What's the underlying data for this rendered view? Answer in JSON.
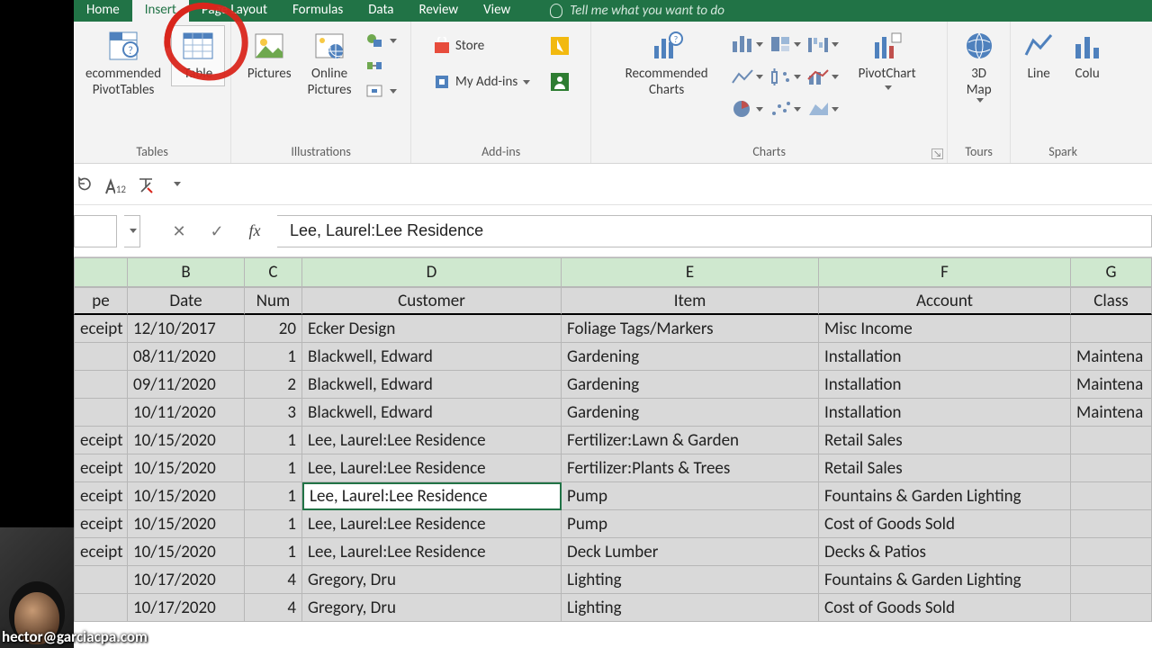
{
  "tabs": {
    "home": "Home",
    "insert": "Insert",
    "page_layout": "Page Layout",
    "formulas": "Formulas",
    "data": "Data",
    "review": "Review",
    "view": "View",
    "tell_me": "Tell me what you want to do"
  },
  "ribbon": {
    "tables_label": "Tables",
    "recommended_pivot": "ecommended\nPivotTables",
    "table": "Table",
    "illustrations_label": "Illustrations",
    "pictures": "Pictures",
    "online_pictures": "Online\nPictures",
    "addins_label": "Add-ins",
    "store": "Store",
    "my_addins": "My Add-ins",
    "charts_label": "Charts",
    "recommended_charts": "Recommended\nCharts",
    "pivot_chart": "PivotChart",
    "tours_label": "Tours",
    "map3d": "3D\nMap",
    "spark_label": "Spark",
    "line": "Line",
    "column": "Colu"
  },
  "qat": {
    "size": "12"
  },
  "formula": {
    "value": "Lee, Laurel:Lee Residence"
  },
  "columns": {
    "A": "",
    "B": "B",
    "C": "C",
    "D": "D",
    "E": "E",
    "F": "F",
    "G": "G"
  },
  "headers": {
    "type": "pe",
    "date": "Date",
    "num": "Num",
    "customer": "Customer",
    "item": "Item",
    "account": "Account",
    "class": "Class"
  },
  "rows": [
    {
      "type": "eceipt",
      "date": "12/10/2017",
      "num": "20",
      "customer": "Ecker Design",
      "item": "Foliage Tags/Markers",
      "account": "Misc Income",
      "class": ""
    },
    {
      "type": "",
      "date": "08/11/2020",
      "num": "1",
      "customer": "Blackwell, Edward",
      "item": "Gardening",
      "account": "Installation",
      "class": "Maintena"
    },
    {
      "type": "",
      "date": "09/11/2020",
      "num": "2",
      "customer": "Blackwell, Edward",
      "item": "Gardening",
      "account": "Installation",
      "class": "Maintena"
    },
    {
      "type": "",
      "date": "10/11/2020",
      "num": "3",
      "customer": "Blackwell, Edward",
      "item": "Gardening",
      "account": "Installation",
      "class": "Maintena"
    },
    {
      "type": "eceipt",
      "date": "10/15/2020",
      "num": "1",
      "customer": "Lee, Laurel:Lee Residence",
      "item": "Fertilizer:Lawn & Garden",
      "account": "Retail Sales",
      "class": ""
    },
    {
      "type": "eceipt",
      "date": "10/15/2020",
      "num": "1",
      "customer": "Lee, Laurel:Lee Residence",
      "item": "Fertilizer:Plants & Trees",
      "account": "Retail Sales",
      "class": ""
    },
    {
      "type": "eceipt",
      "date": "10/15/2020",
      "num": "1",
      "customer": "Lee, Laurel:Lee Residence",
      "item": "Pump",
      "account": "Fountains & Garden Lighting",
      "class": "",
      "selected": true
    },
    {
      "type": "eceipt",
      "date": "10/15/2020",
      "num": "1",
      "customer": "Lee, Laurel:Lee Residence",
      "item": "Pump",
      "account": "Cost of Goods Sold",
      "class": ""
    },
    {
      "type": "eceipt",
      "date": "10/15/2020",
      "num": "1",
      "customer": "Lee, Laurel:Lee Residence",
      "item": "Deck Lumber",
      "account": "Decks & Patios",
      "class": ""
    },
    {
      "type": "",
      "date": "10/17/2020",
      "num": "4",
      "customer": "Gregory, Dru",
      "item": "Lighting",
      "account": "Fountains & Garden Lighting",
      "class": ""
    },
    {
      "type": "",
      "date": "10/17/2020",
      "num": "4",
      "customer": "Gregory, Dru",
      "item": "Lighting",
      "account": "Cost of Goods Sold",
      "class": ""
    }
  ],
  "overlay": {
    "email": "hector@garciacpa.com"
  }
}
